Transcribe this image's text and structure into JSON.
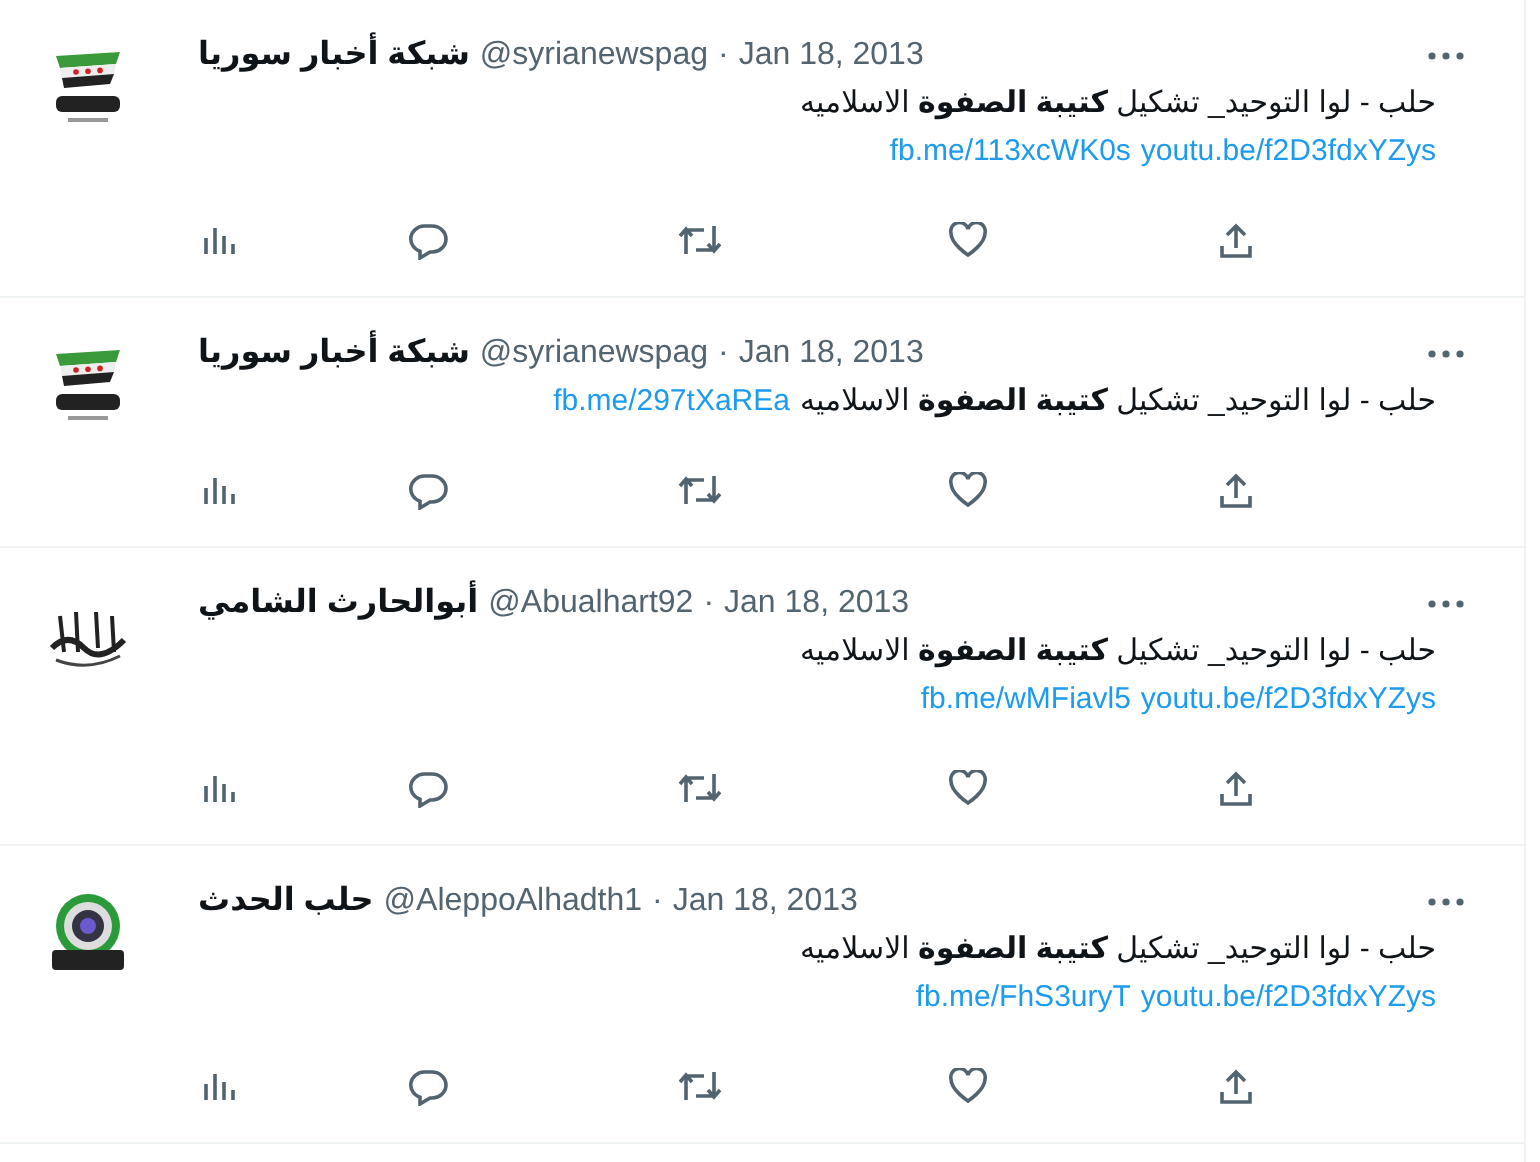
{
  "tweets": [
    {
      "name": "شبكة أخبار سوريا",
      "handle": "@syrianewspag",
      "sep": "·",
      "date": "Jan 18, 2013",
      "text": "حلب - لوا التوحيد_ تشكيل **كتيبة الصفوة** الاسلاميه",
      "links": [
        "youtu.be/f2D3fdxYZys",
        "fb.me/113xcWK0s"
      ],
      "links_inline": false
    },
    {
      "name": "شبكة أخبار سوريا",
      "handle": "@syrianewspag",
      "sep": "·",
      "date": "Jan 18, 2013",
      "text": "حلب - لوا التوحيد_ تشكيل **كتيبة الصفوة** الاسلاميه",
      "links": [
        "fb.me/297tXaREa"
      ],
      "links_inline": true
    },
    {
      "name": "أبوالحارث الشامي",
      "handle": "@Abualhart92",
      "sep": "·",
      "date": "Jan 18, 2013",
      "text": "حلب - لوا التوحيد_ تشكيل **كتيبة الصفوة** الاسلاميه",
      "links": [
        "youtu.be/f2D3fdxYZys",
        "fb.me/wMFiavl5"
      ],
      "links_inline": false
    },
    {
      "name": "حلب الحدث",
      "handle": "@AleppoAlhadth1",
      "sep": "·",
      "date": "Jan 18, 2013",
      "text": "حلب - لوا التوحيد_ تشكيل **كتيبة الصفوة** الاسلاميه",
      "links": [
        "youtu.be/f2D3fdxYZys",
        "fb.me/FhS3uryT"
      ],
      "links_inline": false
    }
  ]
}
